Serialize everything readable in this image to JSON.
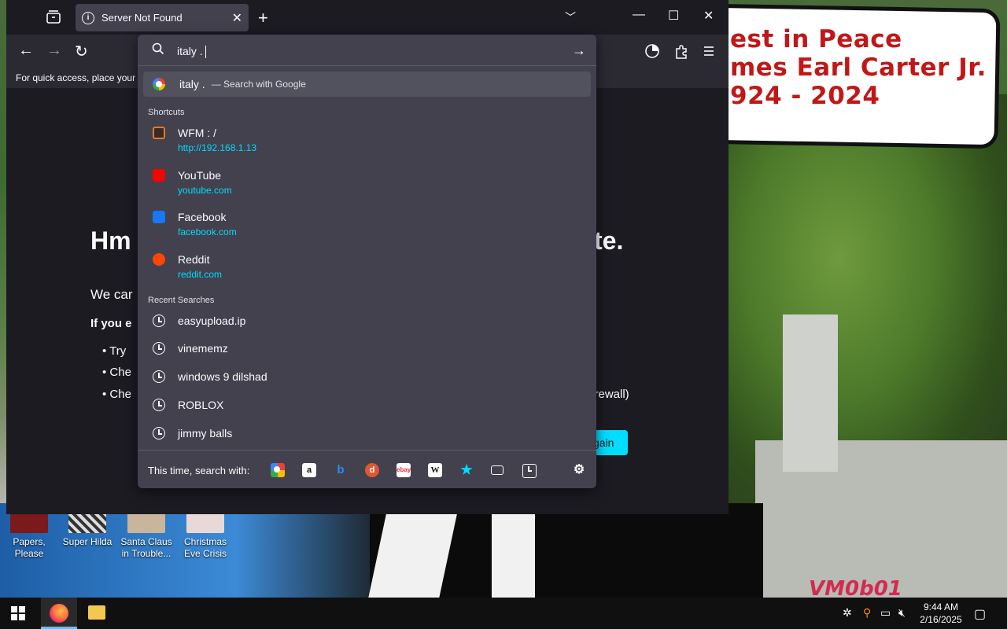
{
  "browser": {
    "tab_title": "Server Not Found",
    "bookmarks_hint": "For quick access, place your b"
  },
  "error_page": {
    "title_left": "Hm",
    "title_right": "te.",
    "para1": "We car",
    "para2": "If you e",
    "bullets": [
      "Try",
      "Che",
      "Che"
    ],
    "bullet3_tail": "firewall)",
    "try_again": "gain"
  },
  "urlbar": {
    "value": "italy .",
    "heuristic": {
      "query": "italy .",
      "action": "— Search with Google"
    },
    "shortcuts_label": "Shortcuts",
    "shortcuts": [
      {
        "title": "WFM : /",
        "url": "http://192.168.1.13",
        "icon": "wfm-icon",
        "color": "#e07a2f"
      },
      {
        "title": "YouTube",
        "url": "youtube.com",
        "icon": "youtube-icon",
        "color": "#ff0000"
      },
      {
        "title": "Facebook",
        "url": "facebook.com",
        "icon": "facebook-icon",
        "color": "#1877f2"
      },
      {
        "title": "Reddit",
        "url": "reddit.com",
        "icon": "reddit-icon",
        "color": "#ff4500"
      }
    ],
    "recent_label": "Recent Searches",
    "recent": [
      "easyupload.ip",
      "vinememz",
      "windows 9 dilshad",
      "ROBLOX",
      "jimmy balls"
    ],
    "footer_label": "This time, search with:",
    "engines": [
      "google-icon",
      "amazon-icon",
      "bing-icon",
      "duckduckgo-icon",
      "ebay-icon",
      "wikipedia-icon",
      "bookmarks-icon",
      "tabs-icon",
      "history-icon"
    ]
  },
  "desktop": {
    "sign_lines": [
      "est in Peace",
      "mes Earl Carter Jr.",
      "924 - 2024"
    ],
    "watermark": "VM0b01",
    "icons": [
      {
        "label": "Papers, Please"
      },
      {
        "label": "Super Hilda"
      },
      {
        "label": "Santa Claus in Trouble..."
      },
      {
        "label": "Christmas Eve Crisis"
      }
    ]
  },
  "taskbar": {
    "time": "9:44 AM",
    "date": "2/16/2025"
  }
}
